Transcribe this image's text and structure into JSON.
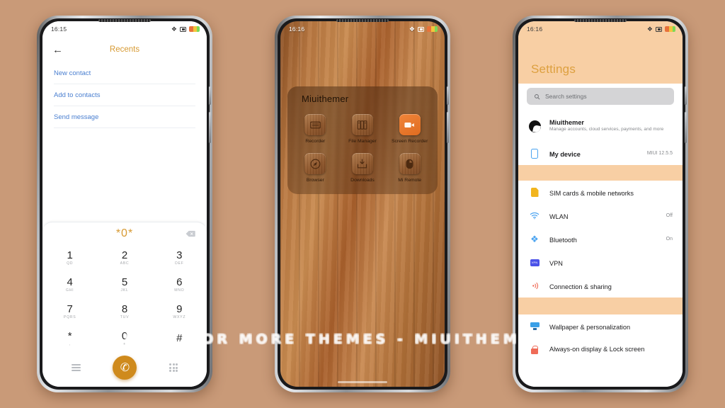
{
  "canvas": {
    "background_color": "#c99a78",
    "watermark": "VISIT FOR MORE THEMES - MIUITHEMER.COM"
  },
  "theme": {
    "accent": "#d79a33",
    "call_button": "#cf8a1c",
    "peach": "#f8cfa4",
    "link_blue": "#4a7fd0"
  },
  "phone1": {
    "status": {
      "time": "16:15",
      "bluetooth_icon": "bluetooth-icon",
      "sim_icon": "sim-status-icon",
      "battery_icon": "battery-icon"
    },
    "appbar": {
      "back_icon": "back-arrow-icon",
      "title": "Recents"
    },
    "actions": [
      {
        "label": "New contact"
      },
      {
        "label": "Add to contacts"
      },
      {
        "label": "Send message"
      }
    ],
    "dialer": {
      "number": "*0*",
      "backspace_icon": "backspace-icon",
      "keys": [
        {
          "digit": "1",
          "letters": "QD"
        },
        {
          "digit": "2",
          "letters": "ABC"
        },
        {
          "digit": "3",
          "letters": "DEF"
        },
        {
          "digit": "4",
          "letters": "GHI"
        },
        {
          "digit": "5",
          "letters": "JKL"
        },
        {
          "digit": "6",
          "letters": "MNO"
        },
        {
          "digit": "7",
          "letters": "PQRS"
        },
        {
          "digit": "8",
          "letters": "TUV"
        },
        {
          "digit": "9",
          "letters": "WXYZ"
        },
        {
          "digit": "*",
          "letters": ","
        },
        {
          "digit": "0",
          "letters": "+"
        },
        {
          "digit": "#",
          "letters": ""
        }
      ],
      "menu_icon": "hamburger-menu-icon",
      "call_icon": "phone-call-icon",
      "keypad_icon": "keypad-grid-icon"
    }
  },
  "phone2": {
    "status": {
      "time": "16:16",
      "bluetooth_icon": "bluetooth-icon",
      "sim_icon": "sim-status-icon",
      "battery_icon": "battery-icon"
    },
    "folder": {
      "title": "Miuithemer",
      "apps": [
        {
          "label": "Recorder",
          "icon": "recorder-icon",
          "accent": false
        },
        {
          "label": "File Manager",
          "icon": "file-manager-icon",
          "accent": false
        },
        {
          "label": "Screen Recorder",
          "icon": "screen-recorder-icon",
          "accent": true
        },
        {
          "label": "Browser",
          "icon": "browser-compass-icon",
          "accent": false
        },
        {
          "label": "Downloads",
          "icon": "downloads-icon",
          "accent": false
        },
        {
          "label": "Mi Remote",
          "icon": "mi-remote-icon",
          "accent": false
        }
      ]
    }
  },
  "phone3": {
    "status": {
      "time": "16:16",
      "bluetooth_icon": "bluetooth-icon",
      "sim_icon": "sim-status-icon",
      "battery_icon": "battery-icon"
    },
    "hero_title": "Settings",
    "search": {
      "placeholder": "Search settings",
      "icon": "search-icon"
    },
    "account": {
      "icon": "avatar-icon",
      "name": "Miuithemer",
      "subtitle": "Manage accounts, cloud services, payments, and more"
    },
    "device": {
      "icon": "device-icon",
      "label": "My device",
      "value": "MIUI 12.5.5"
    },
    "group1": [
      {
        "icon": "sim-card-icon",
        "label": "SIM cards & mobile networks",
        "value": ""
      },
      {
        "icon": "wifi-icon",
        "label": "WLAN",
        "value": "Off"
      },
      {
        "icon": "bluetooth-icon",
        "label": "Bluetooth",
        "value": "On"
      },
      {
        "icon": "vpn-icon",
        "label": "VPN",
        "value": ""
      },
      {
        "icon": "connection-sharing-icon",
        "label": "Connection & sharing",
        "value": ""
      }
    ],
    "group2": [
      {
        "icon": "wallpaper-icon",
        "label": "Wallpaper & personalization",
        "value": ""
      },
      {
        "icon": "lock-icon",
        "label": "Always-on display & Lock screen",
        "value": ""
      }
    ]
  }
}
